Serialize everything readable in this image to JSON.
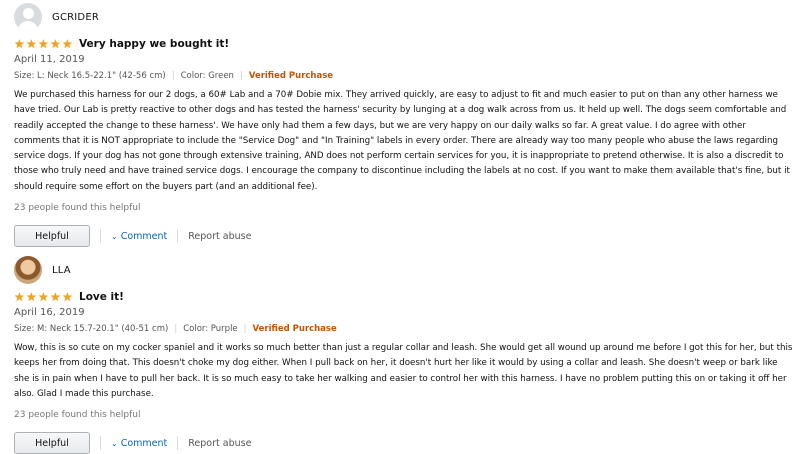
{
  "reviews": [
    {
      "profile_name": "GCRIDER",
      "title": "Very happy we bought it!",
      "stars": 5,
      "date": "April 11, 2019",
      "size": "Size: L: Neck 16.5-22.1\" (42-56 cm)",
      "color": "Color: Green",
      "verified": "Verified Purchase",
      "body": "We purchased this harness for our 2 dogs, a 60# Lab and a 70# Dobie mix. They arrived quickly, are easy to adjust to fit and much easier to put on than any other harness we have tried. Our Lab is pretty reactive to other dogs and has tested the harness' security by lunging at a dog walk across from us. It held up well. The dogs seem comfortable and readily accepted the change to these harness'. We have only had them a few days, but we are very happy on our daily walks so far. A great value. I do agree with other comments that it is NOT appropriate to include the \"Service Dog\" and \"In Training\" labels in every order. There are already way too many people who abuse the laws regarding service dogs. If your dog has not gone through extensive training, AND does not perform certain services for you, it is inappropriate to pretend otherwise. It is also a discredit to those who truly need and have trained service dogs. I encourage the company to discontinue including the labels at no cost. If you want to make them available that's fine, but it should require some effort on the buyers part (and an additional fee).",
      "helpful_count": "23 people found this helpful",
      "helpful_label": "Helpful",
      "comment_label": "Comment",
      "report_label": "Report abuse"
    },
    {
      "profile_name": "LLA",
      "title": "Love it!",
      "stars": 5,
      "date": "April 16, 2019",
      "size": "Size: M: Neck 15.7-20.1\" (40-51 cm)",
      "color": "Color: Purple",
      "verified": "Verified Purchase",
      "body": "Wow, this is so cute on my cocker spaniel and it works so much better than just a regular collar and leash. She would get all wound up around me before I got this for her, but this keeps her from doing that. This doesn't choke my dog either. When I pull back on her, it doesn't hurt her like it would by using a collar and leash. She doesn't weep or bark like she is in pain when I have to pull her back. It is so much easy to take her walking and easier to control her with this harness. I have no problem putting this on or taking it off her also. Glad I made this purchase.",
      "helpful_count": "23 people found this helpful",
      "helpful_label": "Helpful",
      "comment_label": "Comment",
      "report_label": "Report abuse"
    }
  ],
  "icons": {
    "star": "★",
    "chevron": "⌄"
  },
  "colors": {
    "star": "#f0a31c",
    "verified": "#c45500",
    "link": "#0066c0"
  }
}
